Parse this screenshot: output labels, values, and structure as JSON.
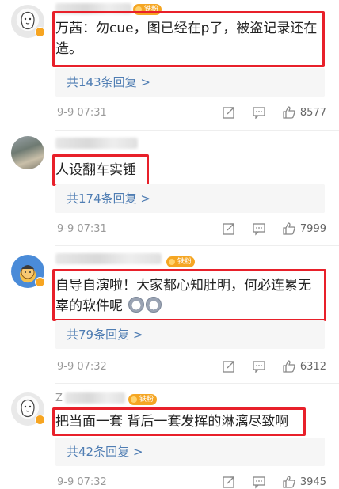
{
  "comments": [
    {
      "text": "万茜：勿cue，图已经在p了，被盗记录还在造。",
      "replies": "共143条回复 >",
      "time": "9-9 07:31",
      "likes": "8577",
      "fan_badge": "铁粉",
      "avatar": "cartoon-character-avatar"
    },
    {
      "text": "人设翻车实锤",
      "replies": "共174条回复 >",
      "time": "9-9 07:31",
      "likes": "7999",
      "avatar": "photo-avatar"
    },
    {
      "text": "自导自演啦！大家都心知肚明，何必连累无辜的软件呢",
      "replies": "共79条回复 >",
      "time": "9-9 07:32",
      "likes": "6312",
      "fan_badge": "铁粉",
      "avatar": "cartoon-kid-avatar",
      "emojis": [
        "husky-emoji",
        "husky-emoji"
      ]
    },
    {
      "text": "把当面一套 背后一套发挥的淋漓尽致啊",
      "replies": "共42条回复 >",
      "time": "9-9 07:32",
      "likes": "3945",
      "fan_badge": "铁粉",
      "name_prefix": "Z",
      "avatar": "cartoon-character-avatar"
    }
  ],
  "icons": {
    "share": "share-icon",
    "comment": "comment-icon",
    "like": "like-icon",
    "verified": "verified-badge-icon"
  },
  "colors": {
    "highlight_box": "#e8202a",
    "reply_link": "#4f7db3",
    "fan_badge": "#f5a623",
    "meta_gray": "#9a9a9a"
  }
}
